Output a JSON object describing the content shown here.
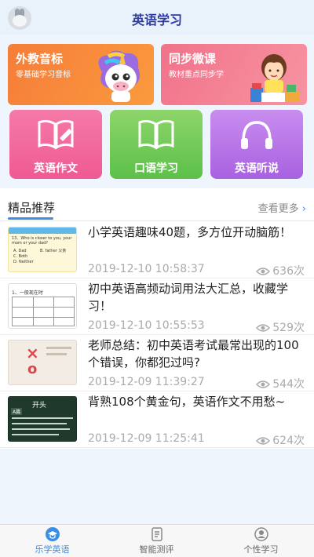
{
  "header": {
    "title": "英语学习"
  },
  "banners": {
    "foreign": {
      "title": "外教音标",
      "subtitle": "零基础学习音标"
    },
    "sync": {
      "title": "同步微课",
      "subtitle": "教材重点同步学"
    }
  },
  "tiles": [
    {
      "label": "英语作文",
      "icon": "writing-book-icon"
    },
    {
      "label": "口语学习",
      "icon": "open-book-icon"
    },
    {
      "label": "英语听说",
      "icon": "headphones-icon"
    }
  ],
  "section": {
    "title": "精品推荐",
    "more": "查看更多",
    "more_chevron": "›"
  },
  "articles": [
    {
      "title": "小学英语趣味40题，多方位开动脑筋！",
      "time": "2019-12-10 10:58:37",
      "views": "636次"
    },
    {
      "title": "初中英语高频动词用法大汇总，收藏学习！",
      "time": "2019-12-10 10:55:53",
      "views": "529次"
    },
    {
      "title": "老师总结：初中英语考试最常出现的100个错误，你都犯过吗?",
      "time": "2019-12-09 11:39:27",
      "views": "544次"
    },
    {
      "title": "背熟108个黄金句，英语作文不用愁~",
      "time": "2019-12-09 11:25:41",
      "views": "624次"
    }
  ],
  "thumbs": {
    "quiz": {
      "q": "13、Who is closer to you, your mom or your dad?",
      "a": "A. Dad",
      "b": "B. father 父亲",
      "c": "C. Both",
      "d": "D. Neither"
    },
    "verbs": {
      "head": "1、一般现在时"
    },
    "errors": {
      "x": "×",
      "o": "o"
    },
    "sentences": {
      "board": "开头",
      "tag": "A篇"
    }
  },
  "tabbar": [
    {
      "label": "乐学英语",
      "icon": "graduation-cap-icon",
      "active": true
    },
    {
      "label": "智能测评",
      "icon": "report-icon",
      "active": false
    },
    {
      "label": "个性学习",
      "icon": "person-icon",
      "active": false
    }
  ],
  "colors": {
    "accent": "#3a8ee6",
    "header_title": "#2c3aa8",
    "foreign_banner": "#f57d3a",
    "sync_banner": "#f1728a",
    "writing_tile": "#ef5a93",
    "speaking_tile": "#5cc04a",
    "listening_tile": "#a861e0"
  }
}
